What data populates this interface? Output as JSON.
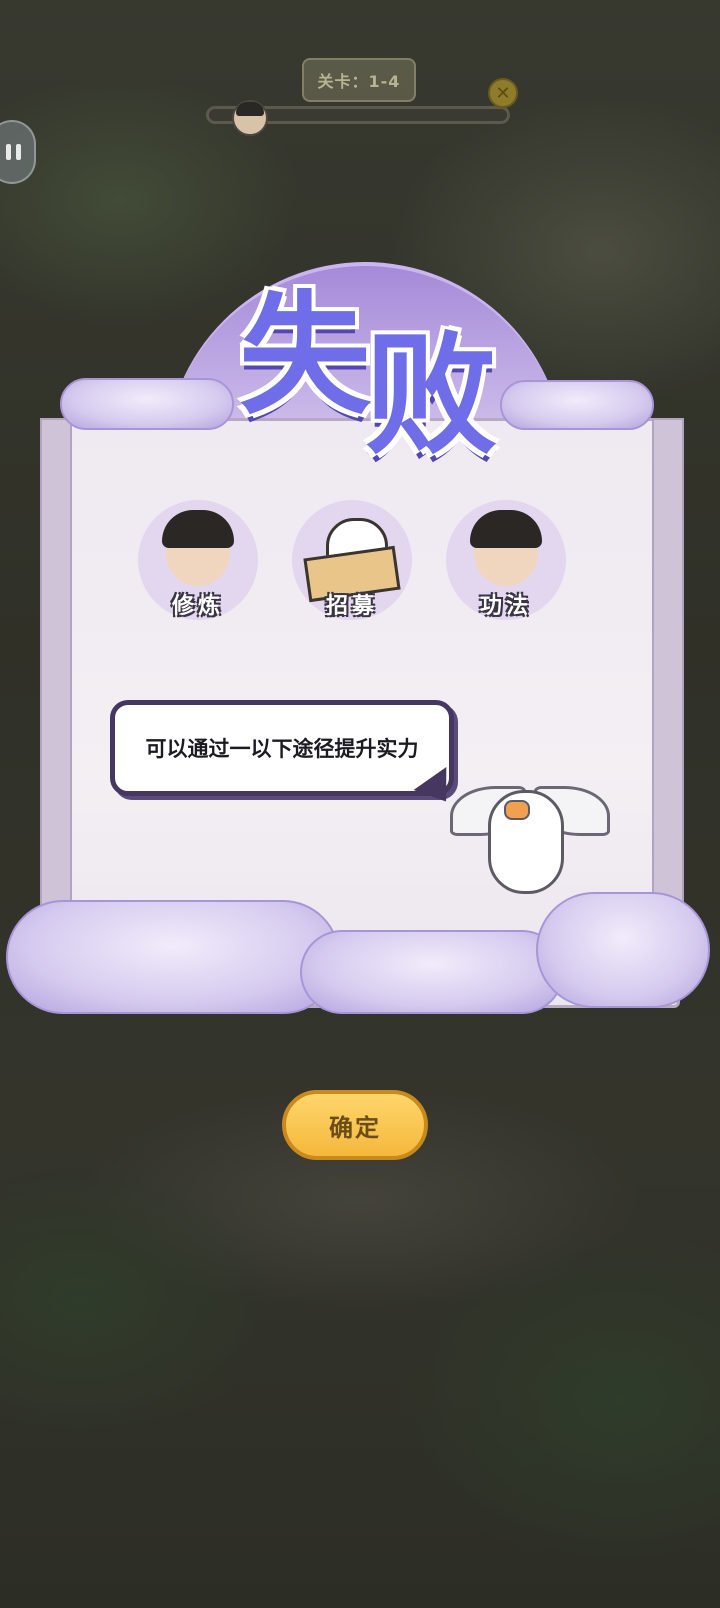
{
  "hud": {
    "level_label": "关卡：1-4",
    "progress": 0.1
  },
  "result": {
    "title_char_1": "失",
    "title_char_2": "败"
  },
  "options": [
    {
      "label": "修炼",
      "icon": "cultivate-icon"
    },
    {
      "label": "招募",
      "icon": "recruit-icon"
    },
    {
      "label": "功法",
      "icon": "skill-book-icon"
    }
  ],
  "tip": {
    "text": "可以通过一以下途径提升实力"
  },
  "confirm": {
    "label": "确定"
  },
  "colors": {
    "title": "#6f6ee8",
    "accent_purple": "#45375f",
    "button_yellow": "#f4b83c"
  }
}
